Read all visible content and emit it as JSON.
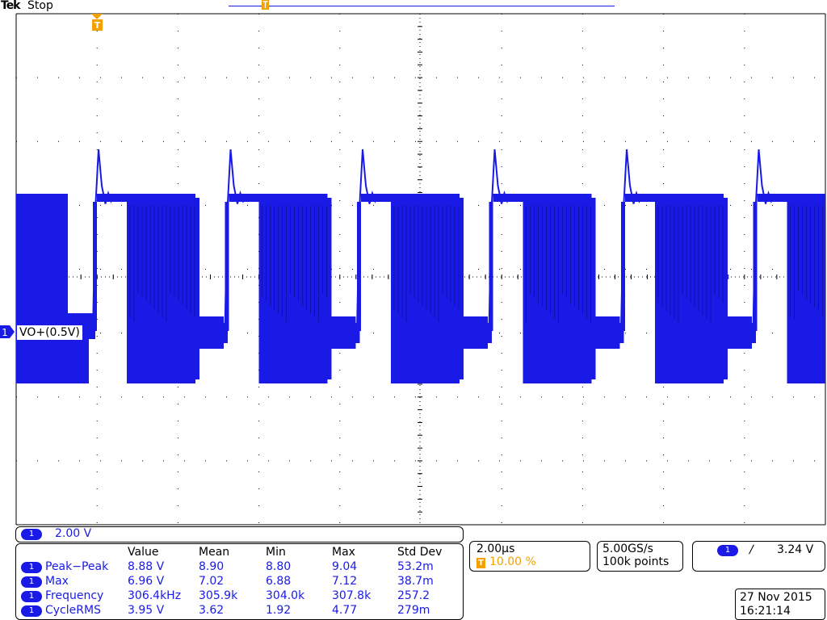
{
  "header": {
    "brand": "Tek",
    "run_state": "Stop"
  },
  "trigger_marker_glyph": "T",
  "channel": {
    "number": "1",
    "label": "VO+(0.5V)",
    "scale": "2.00 V",
    "color": "#1a1ae6"
  },
  "measurements": {
    "columns": [
      "Value",
      "Mean",
      "Min",
      "Max",
      "Std Dev"
    ],
    "rows": [
      {
        "ch": "1",
        "name": "Peak−Peak",
        "cells": [
          "8.88 V",
          "8.90",
          "8.80",
          "9.04",
          "53.2m"
        ]
      },
      {
        "ch": "1",
        "name": "Max",
        "cells": [
          "6.96 V",
          "7.02",
          "6.88",
          "7.12",
          "38.7m"
        ]
      },
      {
        "ch": "1",
        "name": "Frequency",
        "cells": [
          "306.4kHz",
          "305.9k",
          "304.0k",
          "307.8k",
          "257.2"
        ]
      },
      {
        "ch": "1",
        "name": "CycleRMS",
        "cells": [
          "3.95 V",
          "3.62",
          "1.92",
          "4.77",
          "279m"
        ]
      }
    ]
  },
  "horizontal": {
    "timebase": "2.00µs",
    "trigger_position_icon": "T",
    "trigger_position": "10.00 %"
  },
  "acquisition": {
    "sample_rate": "5.00GS/s",
    "record_length": "100k points"
  },
  "trigger": {
    "source": "1",
    "slope_glyph": "∕",
    "slope_icon": "rising-edge-icon",
    "level": "3.24 V"
  },
  "datetime": {
    "date": "27 Nov 2015",
    "time": "16:21:14"
  },
  "colors": {
    "trace": "#1a1ae6",
    "trigger_marker": "#f2a100",
    "grid": "#000000"
  }
}
